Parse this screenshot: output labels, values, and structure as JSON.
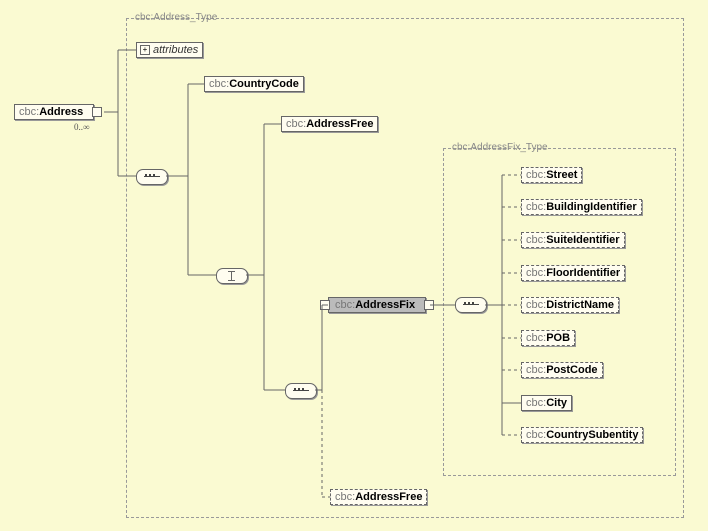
{
  "root": {
    "prefix": "cbc:",
    "name": "Address",
    "occurs": "0..∞"
  },
  "outerGroup": {
    "label": "cbc:Address_Type"
  },
  "attributes": {
    "label": "attributes"
  },
  "countryCode": {
    "prefix": "cbc:",
    "name": "CountryCode"
  },
  "addressFree1": {
    "prefix": "cbc:",
    "name": "AddressFree"
  },
  "addressFix": {
    "prefix": "cbc:",
    "name": "AddressFix"
  },
  "addressFree2": {
    "prefix": "cbc:",
    "name": "AddressFree"
  },
  "innerGroup": {
    "label": "cbc:AddressFix_Type"
  },
  "fix": {
    "street": {
      "prefix": "cbc:",
      "name": "Street"
    },
    "building": {
      "prefix": "cbc:",
      "name": "BuildingIdentifier"
    },
    "suite": {
      "prefix": "cbc:",
      "name": "SuiteIdentifier"
    },
    "floor": {
      "prefix": "cbc:",
      "name": "FloorIdentifier"
    },
    "district": {
      "prefix": "cbc:",
      "name": "DistrictName"
    },
    "pob": {
      "prefix": "cbc:",
      "name": "POB"
    },
    "postcode": {
      "prefix": "cbc:",
      "name": "PostCode"
    },
    "city": {
      "prefix": "cbc:",
      "name": "City"
    },
    "subent": {
      "prefix": "cbc:",
      "name": "CountrySubentity"
    }
  }
}
